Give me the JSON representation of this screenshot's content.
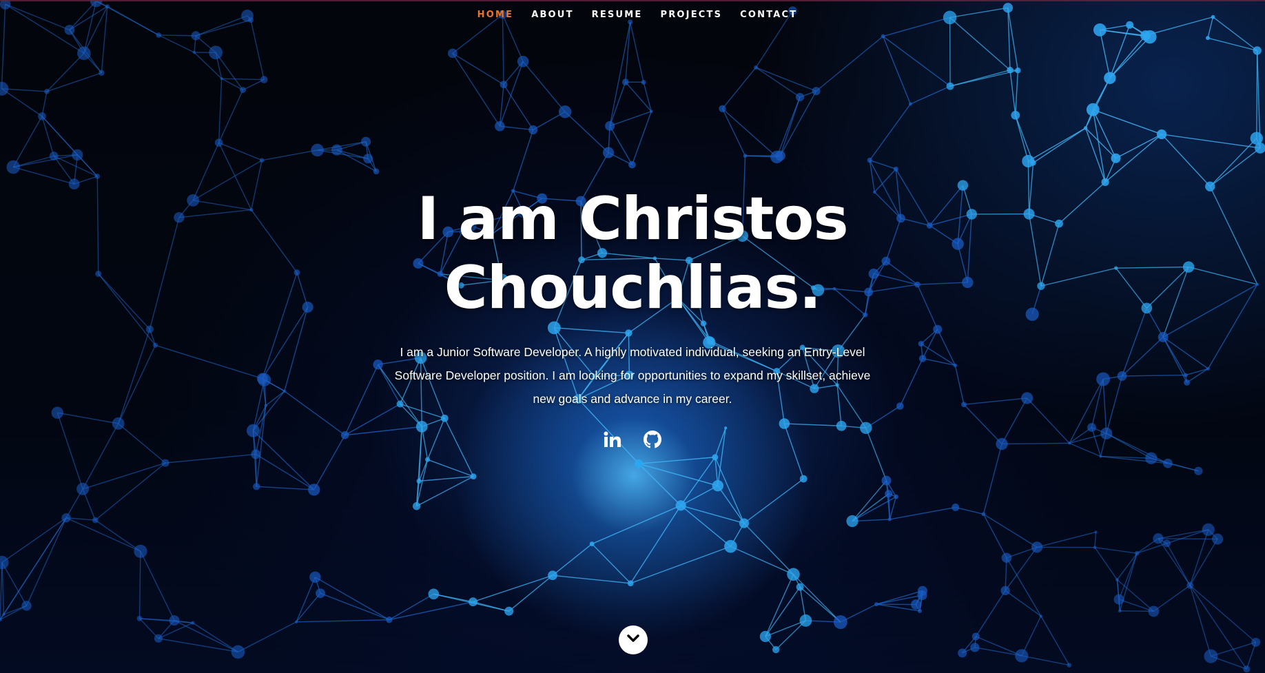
{
  "nav": {
    "items": [
      {
        "label": "HOME",
        "active": true
      },
      {
        "label": "ABOUT",
        "active": false
      },
      {
        "label": "RESUME",
        "active": false
      },
      {
        "label": "PROJECTS",
        "active": false
      },
      {
        "label": "CONTACT",
        "active": false
      }
    ]
  },
  "hero": {
    "title_line1": "I am Christos",
    "title_line2": "Chouchlias.",
    "description": "I am a Junior Software Developer. A highly motivated individual, seeking an Entry-Level Software Developer position. I am looking for opportunities to expand my skillset, achieve new goals and advance in my career."
  },
  "social": {
    "links": [
      {
        "icon": "linkedin-icon"
      },
      {
        "icon": "github-icon"
      }
    ]
  },
  "scroll": {
    "icon": "chevron-down-icon"
  },
  "colors": {
    "accent": "#e8752a",
    "text": "#ffffff",
    "network_line": "#2a9be6",
    "background": "#02040a"
  }
}
